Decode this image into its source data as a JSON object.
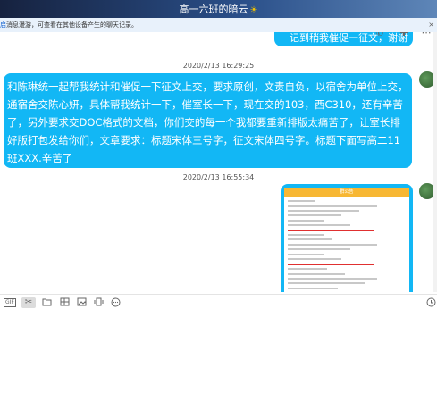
{
  "window": {
    "title": "高一六班的暗云",
    "title_icon": "sun-icon"
  },
  "notice": {
    "lead": "启",
    "text": "消息漫游，可查看在其他设备产生的聊天记录。",
    "close": "×"
  },
  "top_tools": {
    "call": "✆",
    "add": "✚",
    "more": "⋯"
  },
  "messages": [
    {
      "type": "text",
      "text": "记到稍我催促一征文，谢谢"
    },
    {
      "type": "time",
      "text": "2020/2/13 16:29:25"
    },
    {
      "type": "text",
      "text": "和陈琳统一起帮我统计和催促一下征文上交，要求原创，文责自负，以宿舍为单位上交，通宿舍交陈心妍，具体帮我统计一下，催室长一下，现在交的103，西C310，还有辛苦了，另外要求交DOC格式的文档，你们交的每一个我都要重新排版太痛苦了，让室长排好版打包发给你们，文章要求：标题宋体三号字，征文宋体四号字。标题下面写高二11班XXX.辛苦了"
    },
    {
      "type": "time",
      "text": "2020/2/13 16:55:34"
    },
    {
      "type": "image",
      "caption": "群公告"
    }
  ],
  "toolbar": {
    "gif": "GIF",
    "icons": [
      "scissors-icon",
      "folder-icon",
      "image-edit-icon",
      "picture-icon",
      "shake-icon",
      "more-icon"
    ],
    "history": "history-icon"
  },
  "colors": {
    "bubble": "#12b7f5",
    "titlebar": "#16223f",
    "notice_bg": "#e8f1fb"
  }
}
